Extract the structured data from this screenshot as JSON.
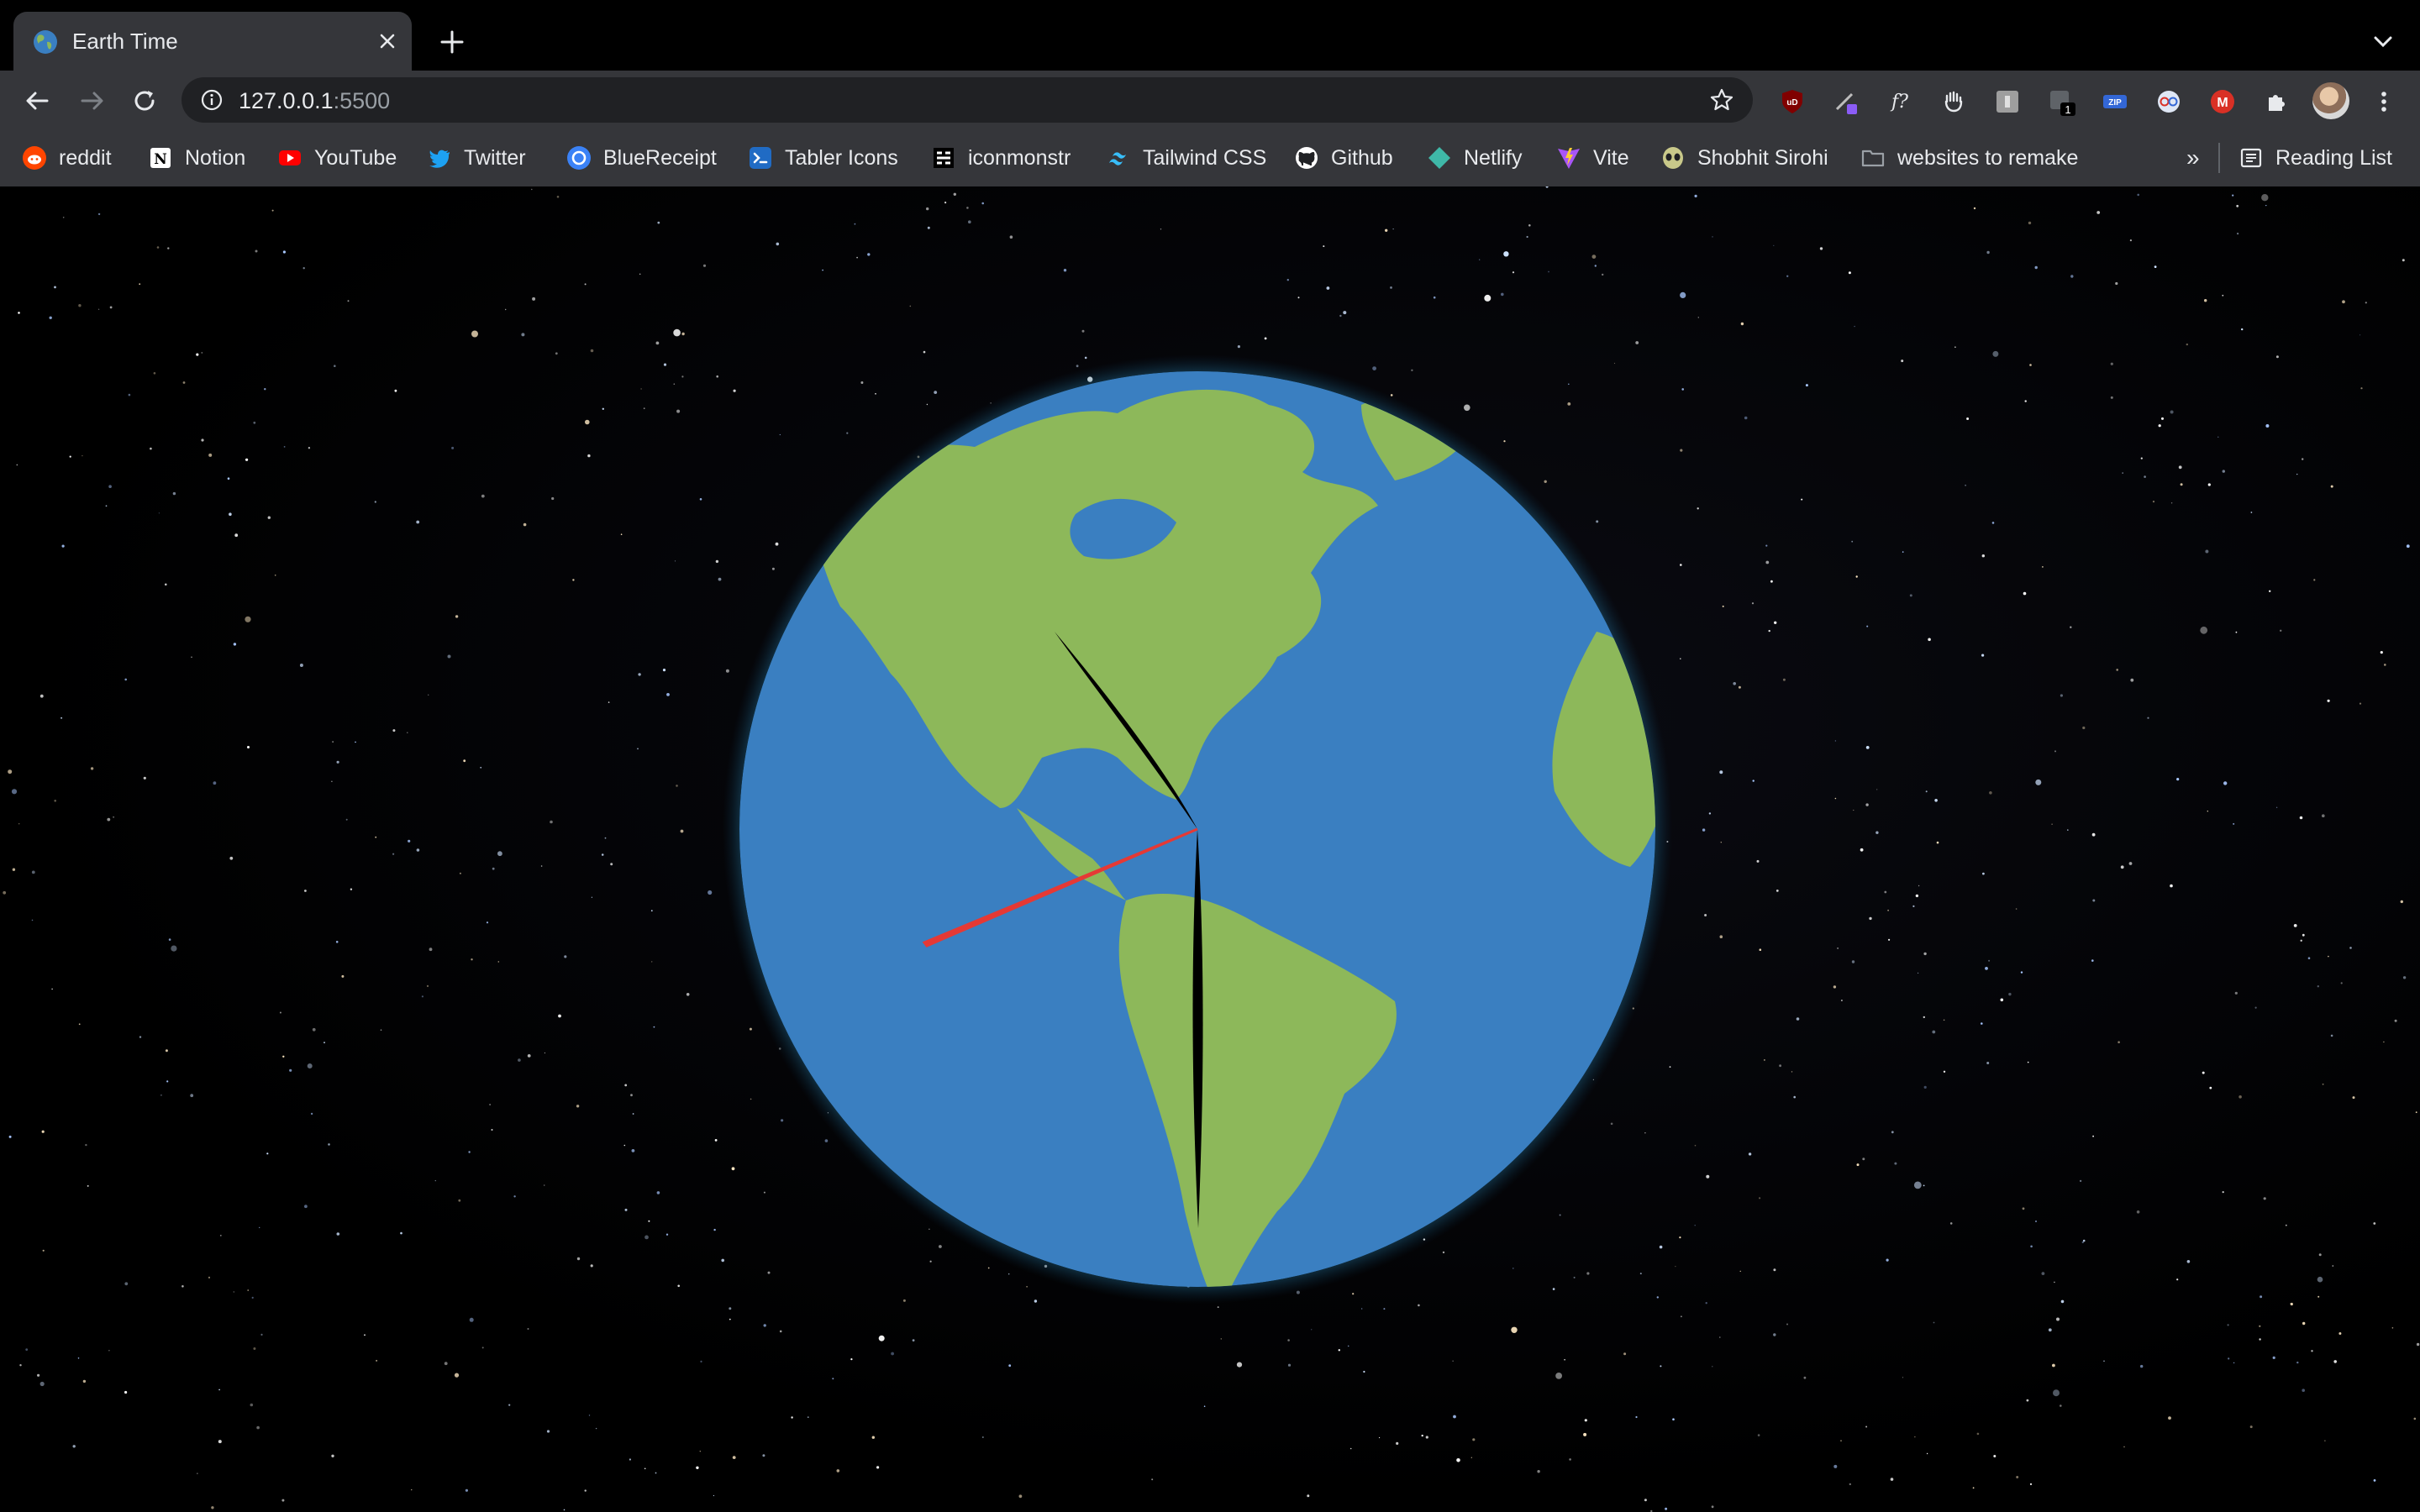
{
  "browser": {
    "tab": {
      "title": "Earth Time",
      "favicon": "globe-icon"
    },
    "address": {
      "host": "127.0.0.1",
      "port": ":5500"
    },
    "bookmarks": [
      {
        "label": "reddit",
        "icon": "reddit-icon",
        "color": "#ff4500"
      },
      {
        "label": "Notion",
        "icon": "notion-icon",
        "color": "#ffffff"
      },
      {
        "label": "YouTube",
        "icon": "youtube-icon",
        "color": "#ff0000"
      },
      {
        "label": "Twitter",
        "icon": "twitter-icon",
        "color": "#1da1f2"
      },
      {
        "label": "BlueReceipt",
        "icon": "bluereceipt-icon",
        "color": "#3b82f6"
      },
      {
        "label": "Tabler Icons",
        "icon": "tabler-icon",
        "color": "#206bc4"
      },
      {
        "label": "iconmonstr",
        "icon": "iconmonstr-icon",
        "color": "#ffffff"
      },
      {
        "label": "Tailwind CSS",
        "icon": "tailwind-icon",
        "color": "#38bdf8"
      },
      {
        "label": "Github",
        "icon": "github-icon",
        "color": "#ffffff"
      },
      {
        "label": "Netlify",
        "icon": "netlify-icon",
        "color": "#3fb8a8"
      },
      {
        "label": "Vite",
        "icon": "vite-icon",
        "color": "#a855f7"
      },
      {
        "label": "Shobhit Sirohi",
        "icon": "alien-icon",
        "color": "#c9c98a"
      },
      {
        "label": "websites to remake",
        "icon": "folder-icon",
        "color": "#9aa0a6"
      }
    ],
    "overflow_label": "»",
    "reading_list": "Reading List",
    "extension_badge": "1"
  },
  "page": {
    "colors": {
      "ocean": "#3a7fc1",
      "land": "#8db85a",
      "glow": "#5ec8f0",
      "second_hand": "#e53935",
      "hands": "#000000"
    }
  }
}
